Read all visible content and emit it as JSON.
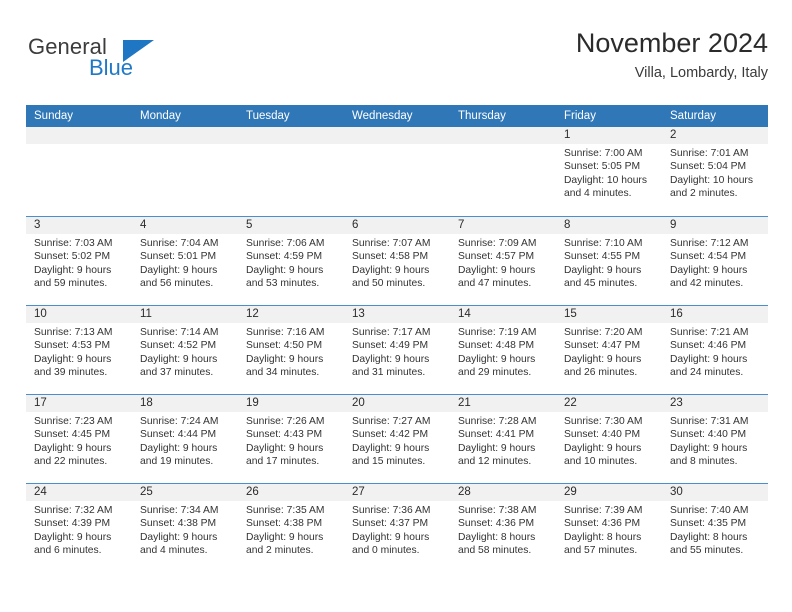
{
  "brand": {
    "word1": "General",
    "word2": "Blue",
    "triangle_color": "#1f76c2",
    "text_color": "#3c3c3c",
    "accent_color": "#2079c6"
  },
  "header": {
    "title": "November 2024",
    "subtitle": "Villa, Lombardy, Italy"
  },
  "theme": {
    "header_bg": "#3077b8",
    "day_band_bg": "#f1f1f1",
    "row_border": "#4a8fcb"
  },
  "weekdays": [
    "Sunday",
    "Monday",
    "Tuesday",
    "Wednesday",
    "Thursday",
    "Friday",
    "Saturday"
  ],
  "weeks": [
    [
      {
        "day": "",
        "sunrise": "",
        "sunset": "",
        "daylight_l1": "",
        "daylight_l2": ""
      },
      {
        "day": "",
        "sunrise": "",
        "sunset": "",
        "daylight_l1": "",
        "daylight_l2": ""
      },
      {
        "day": "",
        "sunrise": "",
        "sunset": "",
        "daylight_l1": "",
        "daylight_l2": ""
      },
      {
        "day": "",
        "sunrise": "",
        "sunset": "",
        "daylight_l1": "",
        "daylight_l2": ""
      },
      {
        "day": "",
        "sunrise": "",
        "sunset": "",
        "daylight_l1": "",
        "daylight_l2": ""
      },
      {
        "day": "1",
        "sunrise": "Sunrise: 7:00 AM",
        "sunset": "Sunset: 5:05 PM",
        "daylight_l1": "Daylight: 10 hours",
        "daylight_l2": "and 4 minutes."
      },
      {
        "day": "2",
        "sunrise": "Sunrise: 7:01 AM",
        "sunset": "Sunset: 5:04 PM",
        "daylight_l1": "Daylight: 10 hours",
        "daylight_l2": "and 2 minutes."
      }
    ],
    [
      {
        "day": "3",
        "sunrise": "Sunrise: 7:03 AM",
        "sunset": "Sunset: 5:02 PM",
        "daylight_l1": "Daylight: 9 hours",
        "daylight_l2": "and 59 minutes."
      },
      {
        "day": "4",
        "sunrise": "Sunrise: 7:04 AM",
        "sunset": "Sunset: 5:01 PM",
        "daylight_l1": "Daylight: 9 hours",
        "daylight_l2": "and 56 minutes."
      },
      {
        "day": "5",
        "sunrise": "Sunrise: 7:06 AM",
        "sunset": "Sunset: 4:59 PM",
        "daylight_l1": "Daylight: 9 hours",
        "daylight_l2": "and 53 minutes."
      },
      {
        "day": "6",
        "sunrise": "Sunrise: 7:07 AM",
        "sunset": "Sunset: 4:58 PM",
        "daylight_l1": "Daylight: 9 hours",
        "daylight_l2": "and 50 minutes."
      },
      {
        "day": "7",
        "sunrise": "Sunrise: 7:09 AM",
        "sunset": "Sunset: 4:57 PM",
        "daylight_l1": "Daylight: 9 hours",
        "daylight_l2": "and 47 minutes."
      },
      {
        "day": "8",
        "sunrise": "Sunrise: 7:10 AM",
        "sunset": "Sunset: 4:55 PM",
        "daylight_l1": "Daylight: 9 hours",
        "daylight_l2": "and 45 minutes."
      },
      {
        "day": "9",
        "sunrise": "Sunrise: 7:12 AM",
        "sunset": "Sunset: 4:54 PM",
        "daylight_l1": "Daylight: 9 hours",
        "daylight_l2": "and 42 minutes."
      }
    ],
    [
      {
        "day": "10",
        "sunrise": "Sunrise: 7:13 AM",
        "sunset": "Sunset: 4:53 PM",
        "daylight_l1": "Daylight: 9 hours",
        "daylight_l2": "and 39 minutes."
      },
      {
        "day": "11",
        "sunrise": "Sunrise: 7:14 AM",
        "sunset": "Sunset: 4:52 PM",
        "daylight_l1": "Daylight: 9 hours",
        "daylight_l2": "and 37 minutes."
      },
      {
        "day": "12",
        "sunrise": "Sunrise: 7:16 AM",
        "sunset": "Sunset: 4:50 PM",
        "daylight_l1": "Daylight: 9 hours",
        "daylight_l2": "and 34 minutes."
      },
      {
        "day": "13",
        "sunrise": "Sunrise: 7:17 AM",
        "sunset": "Sunset: 4:49 PM",
        "daylight_l1": "Daylight: 9 hours",
        "daylight_l2": "and 31 minutes."
      },
      {
        "day": "14",
        "sunrise": "Sunrise: 7:19 AM",
        "sunset": "Sunset: 4:48 PM",
        "daylight_l1": "Daylight: 9 hours",
        "daylight_l2": "and 29 minutes."
      },
      {
        "day": "15",
        "sunrise": "Sunrise: 7:20 AM",
        "sunset": "Sunset: 4:47 PM",
        "daylight_l1": "Daylight: 9 hours",
        "daylight_l2": "and 26 minutes."
      },
      {
        "day": "16",
        "sunrise": "Sunrise: 7:21 AM",
        "sunset": "Sunset: 4:46 PM",
        "daylight_l1": "Daylight: 9 hours",
        "daylight_l2": "and 24 minutes."
      }
    ],
    [
      {
        "day": "17",
        "sunrise": "Sunrise: 7:23 AM",
        "sunset": "Sunset: 4:45 PM",
        "daylight_l1": "Daylight: 9 hours",
        "daylight_l2": "and 22 minutes."
      },
      {
        "day": "18",
        "sunrise": "Sunrise: 7:24 AM",
        "sunset": "Sunset: 4:44 PM",
        "daylight_l1": "Daylight: 9 hours",
        "daylight_l2": "and 19 minutes."
      },
      {
        "day": "19",
        "sunrise": "Sunrise: 7:26 AM",
        "sunset": "Sunset: 4:43 PM",
        "daylight_l1": "Daylight: 9 hours",
        "daylight_l2": "and 17 minutes."
      },
      {
        "day": "20",
        "sunrise": "Sunrise: 7:27 AM",
        "sunset": "Sunset: 4:42 PM",
        "daylight_l1": "Daylight: 9 hours",
        "daylight_l2": "and 15 minutes."
      },
      {
        "day": "21",
        "sunrise": "Sunrise: 7:28 AM",
        "sunset": "Sunset: 4:41 PM",
        "daylight_l1": "Daylight: 9 hours",
        "daylight_l2": "and 12 minutes."
      },
      {
        "day": "22",
        "sunrise": "Sunrise: 7:30 AM",
        "sunset": "Sunset: 4:40 PM",
        "daylight_l1": "Daylight: 9 hours",
        "daylight_l2": "and 10 minutes."
      },
      {
        "day": "23",
        "sunrise": "Sunrise: 7:31 AM",
        "sunset": "Sunset: 4:40 PM",
        "daylight_l1": "Daylight: 9 hours",
        "daylight_l2": "and 8 minutes."
      }
    ],
    [
      {
        "day": "24",
        "sunrise": "Sunrise: 7:32 AM",
        "sunset": "Sunset: 4:39 PM",
        "daylight_l1": "Daylight: 9 hours",
        "daylight_l2": "and 6 minutes."
      },
      {
        "day": "25",
        "sunrise": "Sunrise: 7:34 AM",
        "sunset": "Sunset: 4:38 PM",
        "daylight_l1": "Daylight: 9 hours",
        "daylight_l2": "and 4 minutes."
      },
      {
        "day": "26",
        "sunrise": "Sunrise: 7:35 AM",
        "sunset": "Sunset: 4:38 PM",
        "daylight_l1": "Daylight: 9 hours",
        "daylight_l2": "and 2 minutes."
      },
      {
        "day": "27",
        "sunrise": "Sunrise: 7:36 AM",
        "sunset": "Sunset: 4:37 PM",
        "daylight_l1": "Daylight: 9 hours",
        "daylight_l2": "and 0 minutes."
      },
      {
        "day": "28",
        "sunrise": "Sunrise: 7:38 AM",
        "sunset": "Sunset: 4:36 PM",
        "daylight_l1": "Daylight: 8 hours",
        "daylight_l2": "and 58 minutes."
      },
      {
        "day": "29",
        "sunrise": "Sunrise: 7:39 AM",
        "sunset": "Sunset: 4:36 PM",
        "daylight_l1": "Daylight: 8 hours",
        "daylight_l2": "and 57 minutes."
      },
      {
        "day": "30",
        "sunrise": "Sunrise: 7:40 AM",
        "sunset": "Sunset: 4:35 PM",
        "daylight_l1": "Daylight: 8 hours",
        "daylight_l2": "and 55 minutes."
      }
    ]
  ]
}
